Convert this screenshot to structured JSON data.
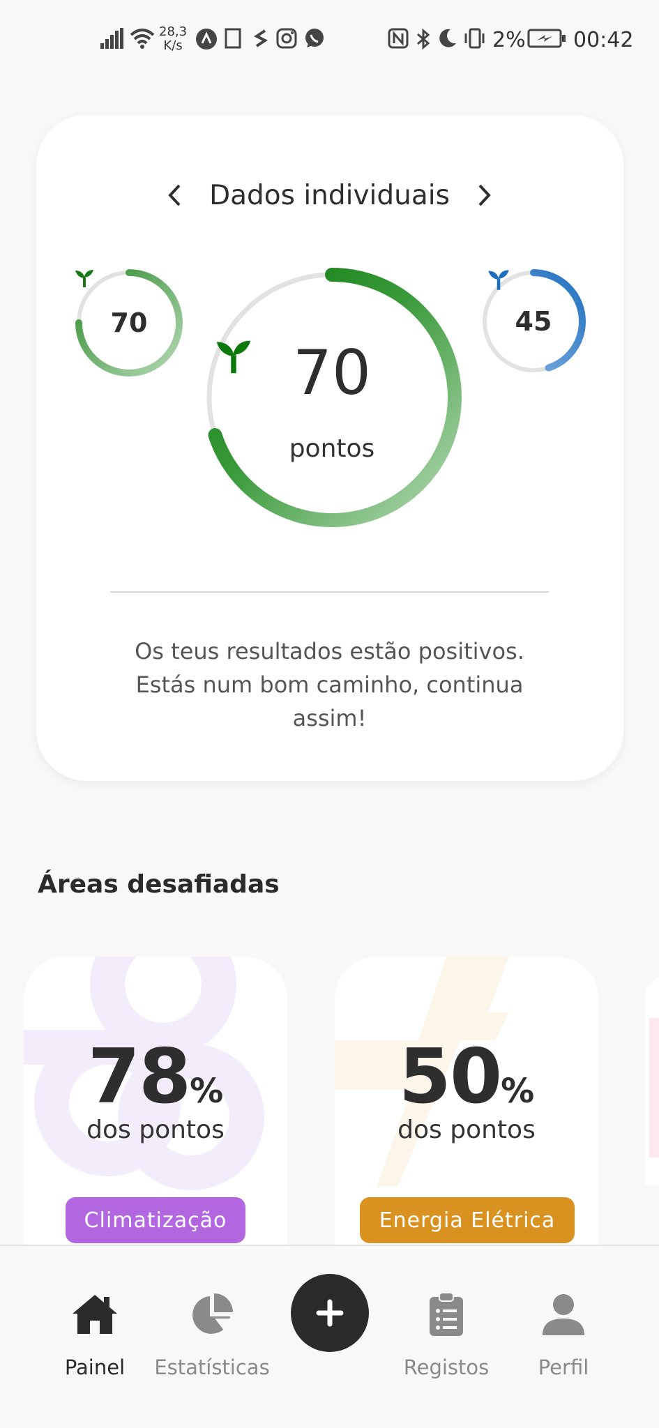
{
  "status_bar": {
    "speed_value": "28,3",
    "speed_unit": "K/s",
    "battery": "2%",
    "time": "00:42"
  },
  "card": {
    "title": "Dados individuais",
    "left_ring": {
      "value": "70",
      "progress": 0.75,
      "color": "#2e8b2e"
    },
    "main_ring": {
      "value": "70",
      "unit": "pontos",
      "progress": 0.7,
      "color": "#0b7a0b"
    },
    "right_ring": {
      "value": "45",
      "progress": 0.45,
      "color": "#1f6fbf"
    },
    "message": "Os teus resultados estão positivos. Estás num bom caminho, continua assim!"
  },
  "areas": {
    "title": "Áreas desafiadas",
    "items": [
      {
        "value": "78",
        "unit": "%",
        "subtitle": "dos pontos",
        "label": "Climatização",
        "color": "#b267e0"
      },
      {
        "value": "50",
        "unit": "%",
        "subtitle": "dos pontos",
        "label": "Energia Elétrica",
        "color": "#d9921f"
      }
    ]
  },
  "nav": {
    "items": [
      {
        "label": "Painel",
        "icon": "home-icon",
        "active": true
      },
      {
        "label": "Estatísticas",
        "icon": "pie-chart-icon",
        "active": false
      },
      {
        "label": "Registos",
        "icon": "clipboard-list-icon",
        "active": false
      },
      {
        "label": "Perfil",
        "icon": "user-icon",
        "active": false
      }
    ],
    "add_icon": "plus-icon"
  }
}
